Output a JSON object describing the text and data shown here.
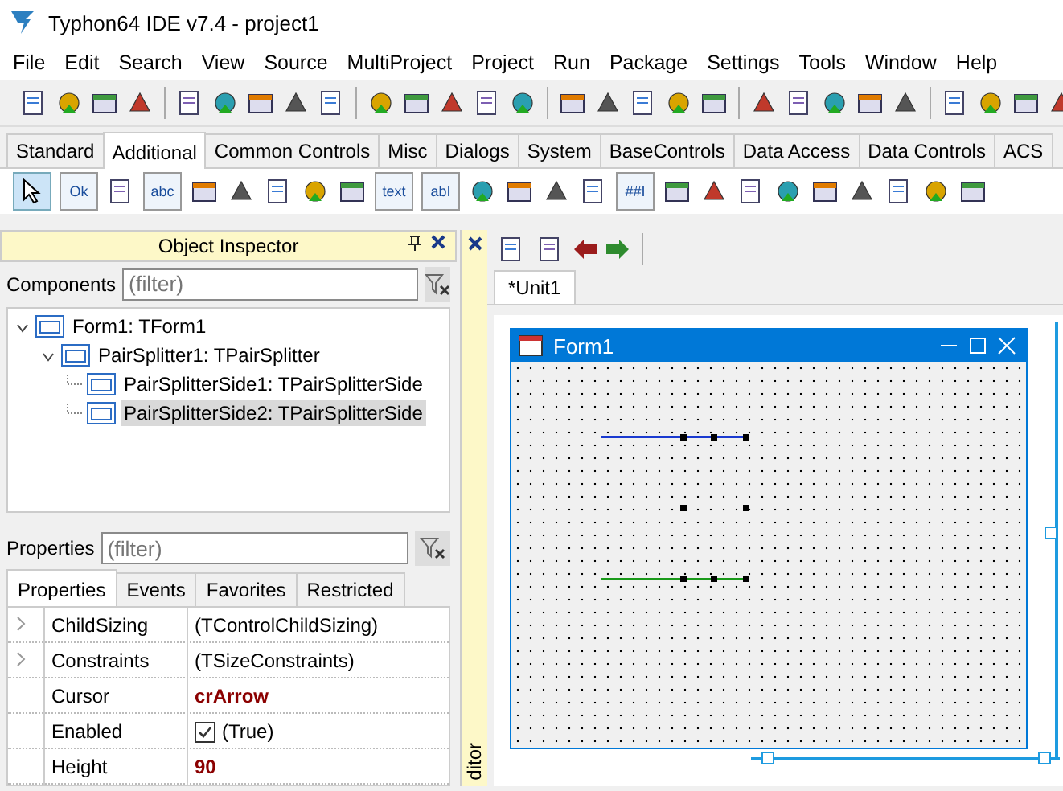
{
  "window": {
    "title": "Typhon64 IDE v7.4 - project1"
  },
  "menu": [
    "File",
    "Edit",
    "Search",
    "View",
    "Source",
    "MultiProject",
    "Project",
    "Run",
    "Package",
    "Settings",
    "Tools",
    "Window",
    "Help"
  ],
  "palette": {
    "tabs": [
      {
        "label": "Standard",
        "selected": false
      },
      {
        "label": "Additional",
        "selected": true
      },
      {
        "label": "Common Controls",
        "selected": false
      },
      {
        "label": "Misc",
        "selected": false
      },
      {
        "label": "Dialogs",
        "selected": false
      },
      {
        "label": "System",
        "selected": false
      },
      {
        "label": "BaseControls",
        "selected": false
      },
      {
        "label": "Data Access",
        "selected": false
      },
      {
        "label": "Data Controls",
        "selected": false
      },
      {
        "label": "ACS",
        "selected": false
      }
    ],
    "icon_captions": [
      "Ok",
      "abc",
      "text",
      "abI",
      "##I"
    ]
  },
  "object_inspector": {
    "title": "Object Inspector",
    "components_label": "Components",
    "components_filter": {
      "placeholder": "(filter)"
    },
    "tree": [
      {
        "label": "Form1: TForm1",
        "selected": false,
        "expanded": true,
        "children": [
          {
            "label": "PairSplitter1: TPairSplitter",
            "selected": false,
            "expanded": true,
            "children": [
              {
                "label": "PairSplitterSide1: TPairSplitterSide",
                "selected": false
              },
              {
                "label": "PairSplitterSide2: TPairSplitterSide",
                "selected": true
              }
            ]
          }
        ]
      }
    ],
    "properties_label": "Properties",
    "properties_filter": {
      "placeholder": "(filter)"
    },
    "tabs": [
      {
        "label": "Properties",
        "selected": true
      },
      {
        "label": "Events",
        "selected": false
      },
      {
        "label": "Favorites",
        "selected": false
      },
      {
        "label": "Restricted",
        "selected": false
      }
    ],
    "rows": [
      {
        "kind": "object",
        "name": "ChildSizing",
        "value": "(TControlChildSizing)",
        "modified": false
      },
      {
        "kind": "object",
        "name": "Constraints",
        "value": "(TSizeConstraints)",
        "modified": false
      },
      {
        "kind": "value",
        "name": "Cursor",
        "value": "crArrow",
        "modified": true
      },
      {
        "kind": "bool",
        "name": "Enabled",
        "value": "(True)",
        "checked": true,
        "modified": false
      },
      {
        "kind": "value",
        "name": "Height",
        "value": "90",
        "modified": true
      }
    ]
  },
  "editor_dock": {
    "label": "ditor"
  },
  "editor": {
    "tabs": [
      {
        "label": "*Unit1",
        "selected": true
      }
    ],
    "form": {
      "title": "Form1"
    }
  }
}
